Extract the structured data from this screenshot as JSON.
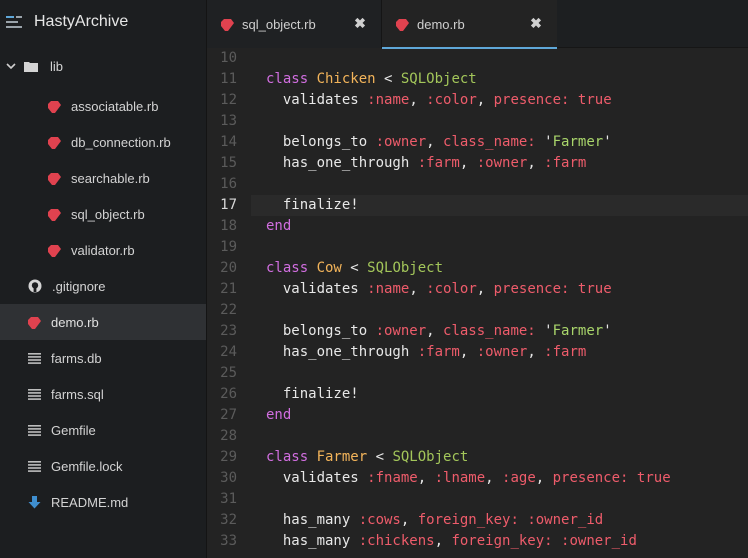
{
  "app": {
    "title": "HastyArchive"
  },
  "sidebar": {
    "folder": {
      "label": "lib"
    },
    "lib_files": [
      {
        "label": "associatable.rb"
      },
      {
        "label": "db_connection.rb"
      },
      {
        "label": "searchable.rb"
      },
      {
        "label": "sql_object.rb"
      },
      {
        "label": "validator.rb"
      }
    ],
    "root_files": [
      {
        "label": ".gitignore",
        "icon": "github-icon"
      },
      {
        "label": "demo.rb",
        "icon": "ruby-icon",
        "active": true
      },
      {
        "label": "farms.db",
        "icon": "text-file-icon"
      },
      {
        "label": "farms.sql",
        "icon": "text-file-icon"
      },
      {
        "label": "Gemfile",
        "icon": "text-file-icon"
      },
      {
        "label": "Gemfile.lock",
        "icon": "text-file-icon"
      },
      {
        "label": "README.md",
        "icon": "download-arrow-icon"
      }
    ]
  },
  "tabs": [
    {
      "label": "sql_object.rb",
      "close": "✖"
    },
    {
      "label": "demo.rb",
      "close": "✖",
      "active": true
    }
  ],
  "editor": {
    "current_line": 17,
    "lines": [
      {
        "n": "10",
        "tokens": []
      },
      {
        "n": "11",
        "tokens": [
          [
            "kw",
            "class "
          ],
          [
            "cls",
            "Chicken "
          ],
          [
            "op",
            "< "
          ],
          [
            "sup",
            "SQLObject"
          ]
        ]
      },
      {
        "n": "12",
        "tokens": [
          [
            "mth",
            "  validates "
          ],
          [
            "sym",
            ":name"
          ],
          [
            "op",
            ", "
          ],
          [
            "sym",
            ":color"
          ],
          [
            "op",
            ", "
          ],
          [
            "sym",
            "presence:"
          ],
          [
            "op",
            " "
          ],
          [
            "bool",
            "true"
          ]
        ]
      },
      {
        "n": "13",
        "tokens": []
      },
      {
        "n": "14",
        "tokens": [
          [
            "mth",
            "  belongs_to "
          ],
          [
            "sym",
            ":owner"
          ],
          [
            "op",
            ", "
          ],
          [
            "sym",
            "class_name:"
          ],
          [
            "op",
            " "
          ],
          [
            "strq",
            "'"
          ],
          [
            "str",
            "Farmer"
          ],
          [
            "strq",
            "'"
          ]
        ]
      },
      {
        "n": "15",
        "tokens": [
          [
            "mth",
            "  has_one_through "
          ],
          [
            "sym",
            ":farm"
          ],
          [
            "op",
            ", "
          ],
          [
            "sym",
            ":owner"
          ],
          [
            "op",
            ", "
          ],
          [
            "sym",
            ":farm"
          ]
        ]
      },
      {
        "n": "16",
        "tokens": []
      },
      {
        "n": "17",
        "tokens": [
          [
            "mth",
            "  finalize!"
          ]
        ]
      },
      {
        "n": "18",
        "tokens": [
          [
            "kw",
            "end"
          ]
        ]
      },
      {
        "n": "19",
        "tokens": []
      },
      {
        "n": "20",
        "tokens": [
          [
            "kw",
            "class "
          ],
          [
            "cls",
            "Cow "
          ],
          [
            "op",
            "< "
          ],
          [
            "sup",
            "SQLObject"
          ]
        ]
      },
      {
        "n": "21",
        "tokens": [
          [
            "mth",
            "  validates "
          ],
          [
            "sym",
            ":name"
          ],
          [
            "op",
            ", "
          ],
          [
            "sym",
            ":color"
          ],
          [
            "op",
            ", "
          ],
          [
            "sym",
            "presence:"
          ],
          [
            "op",
            " "
          ],
          [
            "bool",
            "true"
          ]
        ]
      },
      {
        "n": "22",
        "tokens": []
      },
      {
        "n": "23",
        "tokens": [
          [
            "mth",
            "  belongs_to "
          ],
          [
            "sym",
            ":owner"
          ],
          [
            "op",
            ", "
          ],
          [
            "sym",
            "class_name:"
          ],
          [
            "op",
            " "
          ],
          [
            "strq",
            "'"
          ],
          [
            "str",
            "Farmer"
          ],
          [
            "strq",
            "'"
          ]
        ]
      },
      {
        "n": "24",
        "tokens": [
          [
            "mth",
            "  has_one_through "
          ],
          [
            "sym",
            ":farm"
          ],
          [
            "op",
            ", "
          ],
          [
            "sym",
            ":owner"
          ],
          [
            "op",
            ", "
          ],
          [
            "sym",
            ":farm"
          ]
        ]
      },
      {
        "n": "25",
        "tokens": []
      },
      {
        "n": "26",
        "tokens": [
          [
            "mth",
            "  finalize!"
          ]
        ]
      },
      {
        "n": "27",
        "tokens": [
          [
            "kw",
            "end"
          ]
        ]
      },
      {
        "n": "28",
        "tokens": []
      },
      {
        "n": "29",
        "tokens": [
          [
            "kw",
            "class "
          ],
          [
            "cls",
            "Farmer "
          ],
          [
            "op",
            "< "
          ],
          [
            "sup",
            "SQLObject"
          ]
        ]
      },
      {
        "n": "30",
        "tokens": [
          [
            "mth",
            "  validates "
          ],
          [
            "sym",
            ":fname"
          ],
          [
            "op",
            ", "
          ],
          [
            "sym",
            ":lname"
          ],
          [
            "op",
            ", "
          ],
          [
            "sym",
            ":age"
          ],
          [
            "op",
            ", "
          ],
          [
            "sym",
            "presence:"
          ],
          [
            "op",
            " "
          ],
          [
            "bool",
            "true"
          ]
        ]
      },
      {
        "n": "31",
        "tokens": []
      },
      {
        "n": "32",
        "tokens": [
          [
            "mth",
            "  has_many "
          ],
          [
            "sym",
            ":cows"
          ],
          [
            "op",
            ", "
          ],
          [
            "sym",
            "foreign_key:"
          ],
          [
            "op",
            " "
          ],
          [
            "sym",
            ":owner_id"
          ]
        ]
      },
      {
        "n": "33",
        "tokens": [
          [
            "mth",
            "  has_many "
          ],
          [
            "sym",
            ":chickens"
          ],
          [
            "op",
            ", "
          ],
          [
            "sym",
            "foreign_key:"
          ],
          [
            "op",
            " "
          ],
          [
            "sym",
            ":owner_id"
          ]
        ]
      }
    ]
  },
  "colors": {
    "ruby": "#e0424f",
    "accent": "#5fa7d8",
    "readme_icon": "#3f8fd0"
  }
}
